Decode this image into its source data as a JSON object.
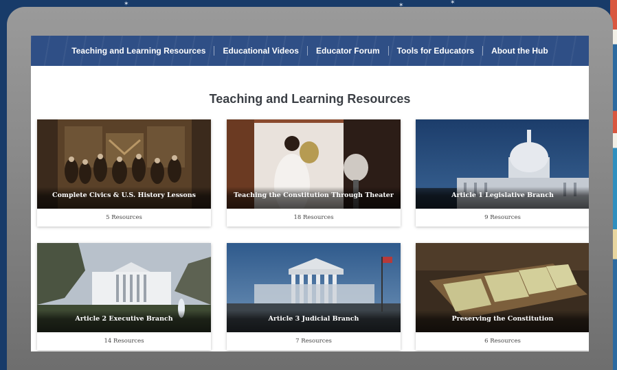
{
  "nav": {
    "items": [
      "Teaching and Learning Resources",
      "Educational Videos",
      "Educator Forum",
      "Tools for Educators",
      "About the Hub"
    ]
  },
  "main": {
    "title": "Teaching and Learning Resources",
    "cards": [
      {
        "title": "Complete Civics & U.S. History Lessons",
        "count": "5 Resources",
        "image": "declaration-painting"
      },
      {
        "title": "Teaching the Constitution Through Theater",
        "count": "18 Resources",
        "image": "theater-performer"
      },
      {
        "title": "Article 1 Legislative Branch",
        "count": "9 Resources",
        "image": "capitol-building"
      },
      {
        "title": "Article 2 Executive Branch",
        "count": "14 Resources",
        "image": "white-house"
      },
      {
        "title": "Article 3 Judicial Branch",
        "count": "7 Resources",
        "image": "supreme-court"
      },
      {
        "title": "Preserving the Constitution",
        "count": "6 Resources",
        "image": "archive-display-cases"
      }
    ]
  },
  "colors": {
    "nav_bg": "#2f4f86",
    "background": "#183b69",
    "frame": "#8a8a8a"
  }
}
